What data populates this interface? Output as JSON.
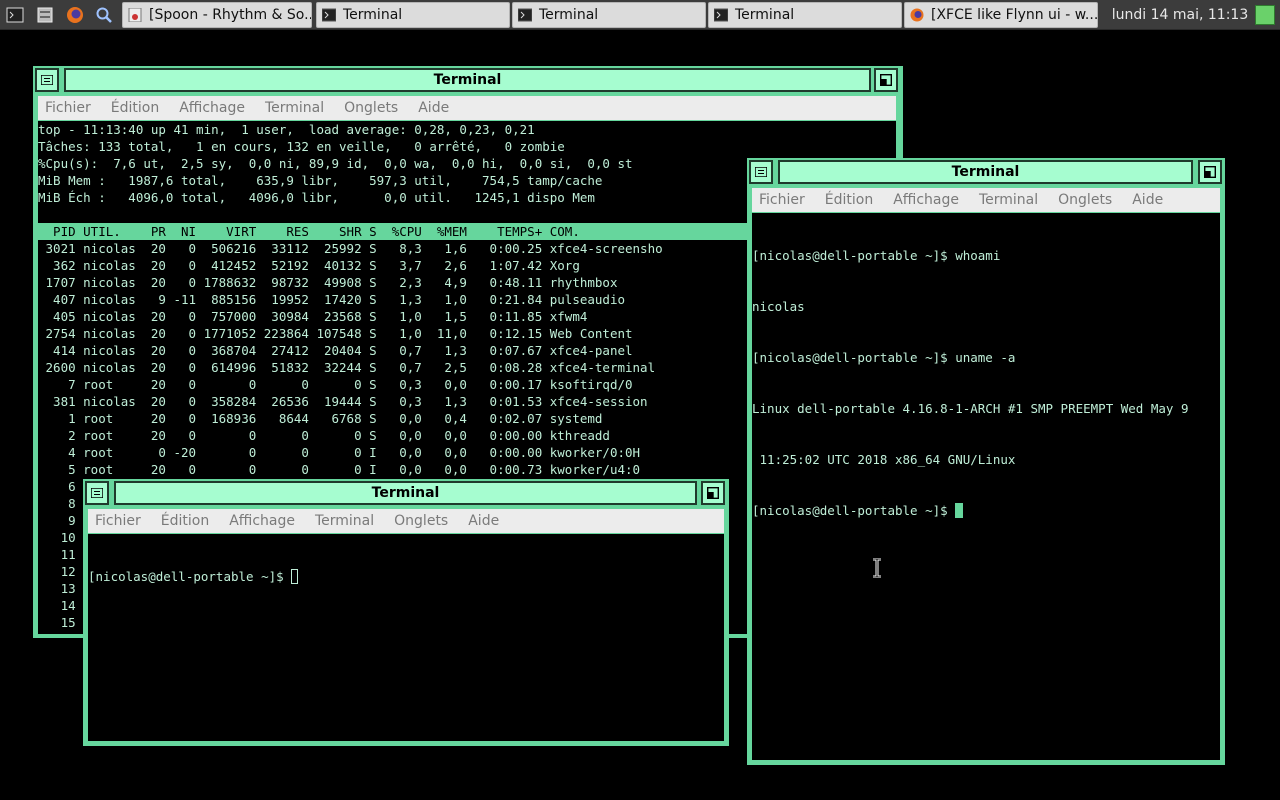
{
  "panel": {
    "launchers": [
      {
        "icon": "terminal-icon"
      },
      {
        "icon": "file-manager-icon"
      },
      {
        "icon": "firefox-icon"
      },
      {
        "icon": "search-icon"
      }
    ],
    "tasks": [
      {
        "label": "[Spoon - Rhythm & So...",
        "icon": "rhythmbox-icon"
      },
      {
        "label": "Terminal",
        "icon": "terminal-icon"
      },
      {
        "label": "Terminal",
        "icon": "terminal-icon"
      },
      {
        "label": "Terminal",
        "icon": "terminal-icon"
      },
      {
        "label": "[XFCE like Flynn ui - w...",
        "icon": "firefox-icon"
      }
    ],
    "clock": "lundi 14 mai, 11:13"
  },
  "menu": [
    "Fichier",
    "Édition",
    "Affichage",
    "Terminal",
    "Onglets",
    "Aide"
  ],
  "win_top": {
    "title": "Terminal",
    "summary": [
      "top - 11:13:40 up 41 min,  1 user,  load average: 0,28, 0,23, 0,21",
      "Tâches: 133 total,   1 en cours, 132 en veille,   0 arrêté,   0 zombie",
      "%Cpu(s):  7,6 ut,  2,5 sy,  0,0 ni, 89,9 id,  0,0 wa,  0,0 hi,  0,0 si,  0,0 st",
      "MiB Mem :   1987,6 total,    635,9 libr,    597,3 util,    754,5 tamp/cache",
      "MiB Éch :   4096,0 total,   4096,0 libr,      0,0 util.   1245,1 dispo Mem"
    ],
    "columns": [
      "PID",
      "UTIL.",
      "PR",
      "NI",
      "VIRT",
      "RES",
      "SHR",
      "S",
      "%CPU",
      "%MEM",
      "TEMPS+",
      "COM."
    ],
    "rows": [
      [
        "3021",
        "nicolas",
        "20",
        "0",
        "506216",
        "33112",
        "25992",
        "S",
        "8,3",
        "1,6",
        "0:00.25",
        "xfce4-screensho"
      ],
      [
        "362",
        "nicolas",
        "20",
        "0",
        "412452",
        "52192",
        "40132",
        "S",
        "3,7",
        "2,6",
        "1:07.42",
        "Xorg"
      ],
      [
        "1707",
        "nicolas",
        "20",
        "0",
        "1788632",
        "98732",
        "49908",
        "S",
        "2,3",
        "4,9",
        "0:48.11",
        "rhythmbox"
      ],
      [
        "407",
        "nicolas",
        "9",
        "-11",
        "885156",
        "19952",
        "17420",
        "S",
        "1,3",
        "1,0",
        "0:21.84",
        "pulseaudio"
      ],
      [
        "405",
        "nicolas",
        "20",
        "0",
        "757000",
        "30984",
        "23568",
        "S",
        "1,0",
        "1,5",
        "0:11.85",
        "xfwm4"
      ],
      [
        "2754",
        "nicolas",
        "20",
        "0",
        "1771052",
        "223864",
        "107548",
        "S",
        "1,0",
        "11,0",
        "0:12.15",
        "Web Content"
      ],
      [
        "414",
        "nicolas",
        "20",
        "0",
        "368704",
        "27412",
        "20404",
        "S",
        "0,7",
        "1,3",
        "0:07.67",
        "xfce4-panel"
      ],
      [
        "2600",
        "nicolas",
        "20",
        "0",
        "614996",
        "51832",
        "32244",
        "S",
        "0,7",
        "2,5",
        "0:08.28",
        "xfce4-terminal"
      ],
      [
        "7",
        "root",
        "20",
        "0",
        "0",
        "0",
        "0",
        "S",
        "0,3",
        "0,0",
        "0:00.17",
        "ksoftirqd/0"
      ],
      [
        "381",
        "nicolas",
        "20",
        "0",
        "358284",
        "26536",
        "19444",
        "S",
        "0,3",
        "1,3",
        "0:01.53",
        "xfce4-session"
      ],
      [
        "1",
        "root",
        "20",
        "0",
        "168936",
        "8644",
        "6768",
        "S",
        "0,0",
        "0,4",
        "0:02.07",
        "systemd"
      ],
      [
        "2",
        "root",
        "20",
        "0",
        "0",
        "0",
        "0",
        "S",
        "0,0",
        "0,0",
        "0:00.00",
        "kthreadd"
      ],
      [
        "4",
        "root",
        "0",
        "-20",
        "0",
        "0",
        "0",
        "I",
        "0,0",
        "0,0",
        "0:00.00",
        "kworker/0:0H"
      ],
      [
        "5",
        "root",
        "20",
        "0",
        "0",
        "0",
        "0",
        "I",
        "0,0",
        "0,0",
        "0:00.73",
        "kworker/u4:0"
      ]
    ],
    "hidden_pids": [
      "6",
      "8",
      "9",
      "10",
      "11",
      "12",
      "13",
      "14",
      "15"
    ]
  },
  "win_right": {
    "title": "Terminal",
    "lines": [
      "[nicolas@dell-portable ~]$ whoami",
      "nicolas",
      "[nicolas@dell-portable ~]$ uname -a",
      "Linux dell-portable 4.16.8-1-ARCH #1 SMP PREEMPT Wed May 9",
      " 11:25:02 UTC 2018 x86_64 GNU/Linux"
    ],
    "prompt": "[nicolas@dell-portable ~]$ "
  },
  "win_bottom": {
    "title": "Terminal",
    "prompt": "[nicolas@dell-portable ~]$ "
  },
  "colors": {
    "accent": "#66d69d",
    "title_bg": "#a6fdd0",
    "menu_bg": "#ececec",
    "panel_bg": "#3c3c3c"
  }
}
